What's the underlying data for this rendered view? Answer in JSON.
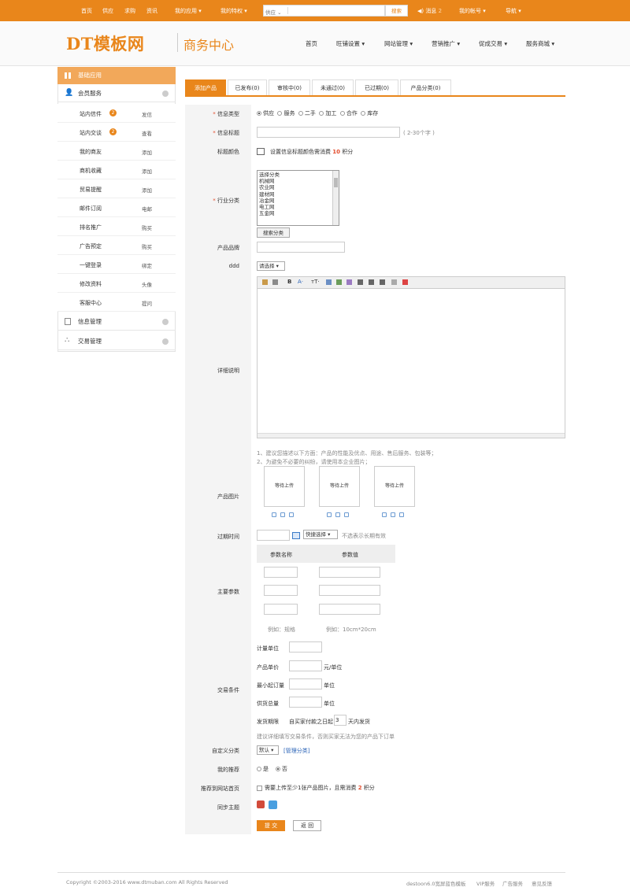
{
  "topbar": {
    "links": [
      "首页",
      "供应",
      "求购",
      "资讯"
    ],
    "my_app": "我的应用",
    "my_privilege": "我的特权",
    "search_select": "供应",
    "search_button": "搜索",
    "message": "消息",
    "message_count": "2",
    "my_account": "我的帐号",
    "navigation": "导航"
  },
  "header": {
    "logo": "DT模板网",
    "subtitle": "商务中心",
    "nav": [
      "首页",
      "旺铺设置",
      "网站管理",
      "营销推广",
      "促成交易",
      "服务商城"
    ]
  },
  "sidebar": {
    "head": "基础应用",
    "section_member": "会员服务",
    "items": [
      {
        "label": "站内信件",
        "badge": "2",
        "action": "发信"
      },
      {
        "label": "站内交谈",
        "badge": "2",
        "action": "查看"
      },
      {
        "label": "我的商友",
        "badge": "",
        "action": "添加"
      },
      {
        "label": "商机收藏",
        "badge": "",
        "action": "添加"
      },
      {
        "label": "贸易提醒",
        "badge": "",
        "action": "添加"
      },
      {
        "label": "邮件订阅",
        "badge": "",
        "action": "电邮"
      },
      {
        "label": "排名推广",
        "badge": "",
        "action": "购买"
      },
      {
        "label": "广告预定",
        "badge": "",
        "action": "购买"
      },
      {
        "label": "一键登录",
        "badge": "",
        "action": "绑定"
      },
      {
        "label": "修改资料",
        "badge": "",
        "action": "头像"
      },
      {
        "label": "客服中心",
        "badge": "",
        "action": "提问"
      }
    ],
    "section_info": "信息管理",
    "section_trade": "交易管理"
  },
  "tabs": [
    "添加产品",
    "已发布(0)",
    "审核中(0)",
    "未通过(0)",
    "已过期(0)",
    "产品分类(0)"
  ],
  "form": {
    "info_type_label": "信息类型",
    "info_types": [
      "供应",
      "服务",
      "二手",
      "加工",
      "合作",
      "库存"
    ],
    "info_title_label": "信息标题",
    "info_title_hint": "( 2-30个字 )",
    "title_color_label": "标题颜色",
    "title_color_text_a": "设置信息标题颜色需消费",
    "title_color_points": "10",
    "title_color_text_b": "积分",
    "industry_label": "行业分类",
    "industry_options": [
      "选择分类",
      "机械网",
      "农业网",
      "建材网",
      "冶金网",
      "电工网",
      "五金网"
    ],
    "search_category_btn": "搜索分类",
    "brand_label": "产品品牌",
    "ddd_label": "ddd",
    "ddd_select": "请选择",
    "detail_label": "详细说明",
    "detail_tip1": "1、建议您描述以下方面：产品的性能及优点、用途、售后服务、包装等；",
    "detail_tip2": "2、为避免不必要的纠纷，请使用本企业图片；",
    "image_label": "产品图片",
    "upload_text": "等待上传",
    "expire_label": "过期时间",
    "expire_quick": "快捷选择",
    "expire_hint": "不选表示长期有效",
    "params_label": "主要参数",
    "param_name_head": "参数名称",
    "param_value_head": "参数值",
    "param_name_eg": "例如：规格",
    "param_value_eg": "例如：10cm*20cm",
    "trade_label": "交易条件",
    "unit_label": "计量单位",
    "price_label": "产品单价",
    "price_suffix": "元/单位",
    "min_order_label": "最小起订量",
    "min_order_suffix": "单位",
    "supply_label": "供货总量",
    "supply_suffix": "单位",
    "ship_label": "发货期限",
    "ship_prefix": "自买家付款之日起",
    "ship_days": "3",
    "ship_suffix": "天内发货",
    "trade_hint": "建议详细填写交易条件，否则买家无法为您的产品下订单",
    "custom_cat_label": "自定义分类",
    "custom_cat_select": "默认",
    "custom_cat_manage": "[管理分类]",
    "recommend_label": "我的推荐",
    "recommend_yes": "是",
    "recommend_no": "否",
    "push_home_label": "推荐到网站首页",
    "push_home_text_a": "需要上传至少1张产品图片，且需消费",
    "push_home_points": "2",
    "push_home_text_b": "积分",
    "sync_label": "同步主题",
    "submit": "提 交",
    "back": "返 回"
  },
  "footer": {
    "copyright": "Copyright ©2003-2016 www.dtmuban.com All Rights Reserved",
    "links": [
      "destoon6.0宽屏蓝色模板",
      "VIP服务",
      "广告服务",
      "意见反馈"
    ]
  },
  "colors": {
    "accent": "#e9861b"
  }
}
